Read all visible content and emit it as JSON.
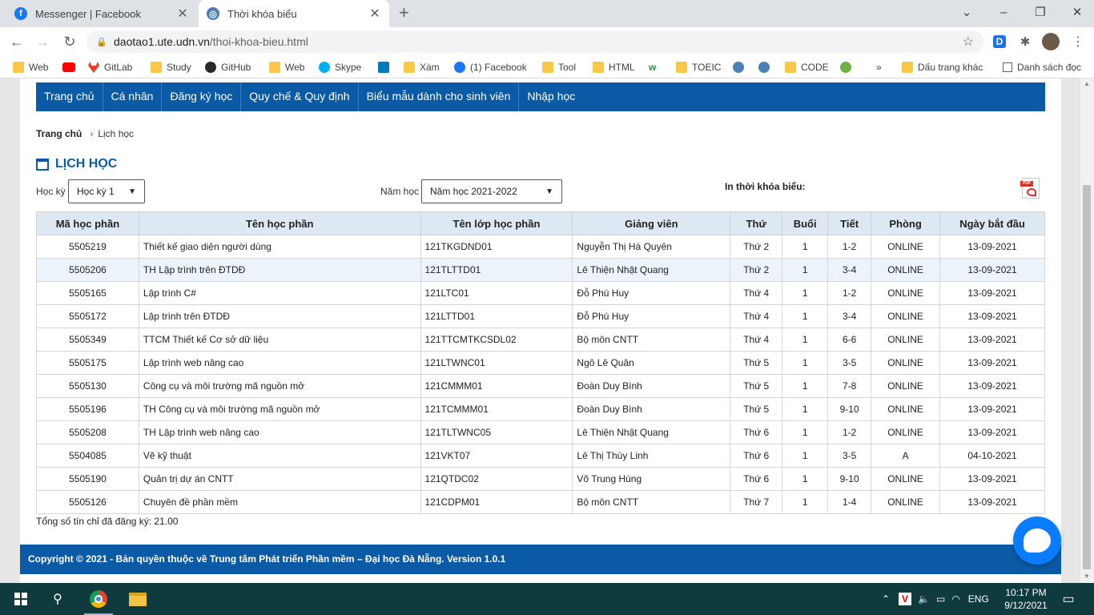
{
  "browser": {
    "tabs": [
      {
        "title": "Messenger | Facebook",
        "active": false
      },
      {
        "title": "Thời khóa biểu",
        "active": true
      }
    ],
    "url_host": "daotao1.ute.udn.vn",
    "url_path": "/thoi-khoa-bieu.html",
    "bookmarks": [
      "Web",
      "",
      "GitLab",
      "Study",
      "GitHub",
      "Web",
      "Skype",
      "",
      "Xàm",
      "(1) Facebook",
      "Tool",
      "HTML",
      "",
      "TOEIC",
      "",
      "",
      "CODE",
      "",
      "»",
      "Dấu trang khác",
      "Danh sách đọc"
    ]
  },
  "nav": [
    "Trang chủ",
    "Cá nhân",
    "Đăng ký học",
    "Quy chế & Quy định",
    "Biểu mẫu dành cho sinh viên",
    "Nhập học"
  ],
  "breadcrumb": {
    "home": "Trang chủ",
    "current": "Lịch học"
  },
  "page_title": "LỊCH HỌC",
  "filters": {
    "semester_label": "Học kỳ",
    "semester_value": "Học kỳ 1",
    "year_label": "Năm học",
    "year_value": "Năm học 2021-2022",
    "print_label": "In thời khóa biểu:"
  },
  "table": {
    "headers": [
      "Mã học phần",
      "Tên học phần",
      "Tên lớp học phần",
      "Giảng viên",
      "Thứ",
      "Buổi",
      "Tiết",
      "Phòng",
      "Ngày bắt đầu"
    ],
    "rows": [
      [
        "5505219",
        "Thiết kế giao diện người dùng",
        "121TKGDND01",
        "Nguyễn Thị Hà Quyên",
        "Thứ 2",
        "1",
        "1-2",
        "ONLINE",
        "13-09-2021"
      ],
      [
        "5505206",
        "TH Lập trình trên ĐTDĐ",
        "121TLTTD01",
        "Lê Thiện Nhật Quang",
        "Thứ 2",
        "1",
        "3-4",
        "ONLINE",
        "13-09-2021"
      ],
      [
        "5505165",
        "Lập trình C#",
        "121LTC01",
        "Đỗ Phú Huy",
        "Thứ 4",
        "1",
        "1-2",
        "ONLINE",
        "13-09-2021"
      ],
      [
        "5505172",
        "Lập trình trên ĐTDĐ",
        "121LTTD01",
        "Đỗ Phú Huy",
        "Thứ 4",
        "1",
        "3-4",
        "ONLINE",
        "13-09-2021"
      ],
      [
        "5505349",
        "TTCM Thiết kế Cơ sở dữ liệu",
        "121TTCMTKCSDL02",
        "Bộ môn CNTT",
        "Thứ 4",
        "1",
        "6-6",
        "ONLINE",
        "13-09-2021"
      ],
      [
        "5505175",
        "Lập trình web nâng cao",
        "121LTWNC01",
        "Ngô Lê Quân",
        "Thứ 5",
        "1",
        "3-5",
        "ONLINE",
        "13-09-2021"
      ],
      [
        "5505130",
        "Công cụ và môi trường mã nguồn mở",
        "121CMMM01",
        "Đoàn Duy Bình",
        "Thứ 5",
        "1",
        "7-8",
        "ONLINE",
        "13-09-2021"
      ],
      [
        "5505196",
        "TH Công cụ và môi trường mã nguồn mở",
        "121TCMMM01",
        "Đoàn Duy Bình",
        "Thứ 5",
        "1",
        "9-10",
        "ONLINE",
        "13-09-2021"
      ],
      [
        "5505208",
        "TH Lập trình web nâng cao",
        "121TLTWNC05",
        "Lê Thiện Nhật Quang",
        "Thứ 6",
        "1",
        "1-2",
        "ONLINE",
        "13-09-2021"
      ],
      [
        "5504085",
        "Vẽ kỹ thuật",
        "121VKT07",
        "Lê Thị Thùy Linh",
        "Thứ 6",
        "1",
        "3-5",
        "A",
        "04-10-2021"
      ],
      [
        "5505190",
        "Quản trị dự án CNTT",
        "121QTDC02",
        "Võ Trung Hùng",
        "Thứ 6",
        "1",
        "9-10",
        "ONLINE",
        "13-09-2021"
      ],
      [
        "5505126",
        "Chuyên đề phần mềm",
        "121CDPM01",
        "Bộ môn CNTT",
        "Thứ 7",
        "1",
        "1-4",
        "ONLINE",
        "13-09-2021"
      ]
    ]
  },
  "total_credits": "Tổng số tín chỉ đã đăng ký: 21.00",
  "footer": "Copyright © 2021 - Bản quyền thuộc về Trung tâm Phát triển Phần mềm – Đại học Đà Nẵng. Version 1.0.1",
  "taskbar": {
    "lang": "ENG",
    "time": "10:17 PM",
    "date": "9/12/2021"
  },
  "colors": {
    "primary": "#0b5aa5",
    "header_bg": "#dde8f3",
    "messenger": "#0a7cff"
  }
}
